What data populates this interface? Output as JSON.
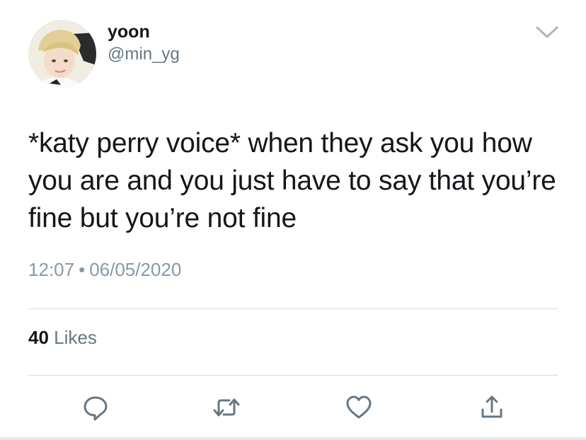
{
  "user": {
    "name": "yoon",
    "handle": "@min_yg"
  },
  "tweet": {
    "text": "*katy perry voice* when they ask you how you are and you just have to say that you’re fine but you’re not fine",
    "time": "12:07",
    "separator": "•",
    "date": "06/05/2020"
  },
  "stats": {
    "likes_count": "40",
    "likes_label": "Likes"
  },
  "icons": {
    "menu": "chevron-down-icon",
    "reply": "reply-icon",
    "retweet": "retweet-icon",
    "like": "heart-icon",
    "share": "share-icon"
  },
  "colors": {
    "icon": "#657786",
    "muted": "#8899a6",
    "text": "#14171a",
    "divider": "#d6dbe0"
  }
}
